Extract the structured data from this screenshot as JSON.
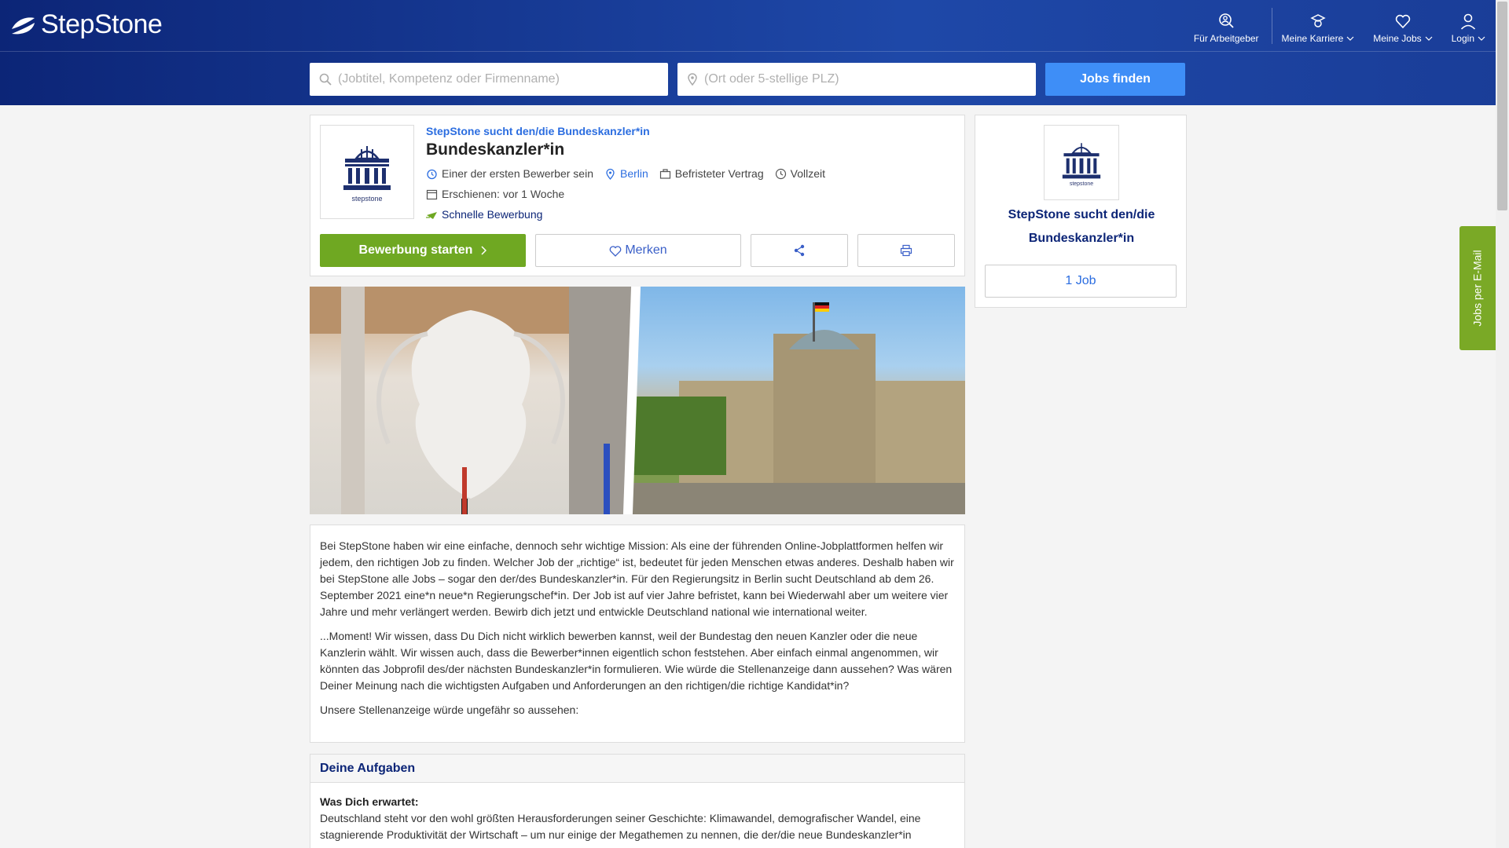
{
  "brand": {
    "name": "StepStone"
  },
  "nav": {
    "employers": "Für Arbeitgeber",
    "career": "Meine Karriere",
    "jobs": "Meine Jobs",
    "login": "Login"
  },
  "search": {
    "keyword_placeholder": "(Jobtitel, Kompetenz oder Firmenname)",
    "location_placeholder": "(Ort oder 5-stellige PLZ)",
    "button": "Jobs finden"
  },
  "job": {
    "company": "StepStone sucht den/die Bundeskanzler*in",
    "title": "Bundeskanzler*in",
    "early_applicant": "Einer der ersten Bewerber sein",
    "location": "Berlin",
    "contract": "Befristeter Vertrag",
    "worktime": "Vollzeit",
    "published": "Erschienen: vor 1 Woche",
    "quick_apply": "Schnelle Bewerbung",
    "logo_caption": "stepstone",
    "apply_button": "Bewerbung starten",
    "save_button": "Merken"
  },
  "description": {
    "p1": "Bei StepStone haben wir eine einfache, dennoch sehr wichtige Mission: Als eine der führenden Online-Jobplattformen helfen wir jedem, den richtigen Job zu finden. Welcher Job der „richtige“ ist, bedeutet für jeden Menschen etwas anderes. Deshalb haben wir bei StepStone alle Jobs – sogar den der/des Bundeskanzler*in. Für den Regierungsitz in Berlin sucht Deutschland ab dem 26. September 2021 eine*n neue*n Regierungschef*in. Der Job ist auf vier Jahre befristet, kann bei Wiederwahl aber um weitere vier Jahre und mehr verlängert werden. Bewirb dich jetzt und entwickle Deutschland national wie international weiter.",
    "p2": "...Moment! Wir wissen, dass Du Dich nicht wirklich bewerben kannst, weil der Bundestag den neuen Kanzler oder die neue Kanzlerin wählt. Wir wissen auch, dass die Bewerber*innen eigentlich schon feststehen. Aber einfach einmal angenommen, wir könnten das Jobprofil des/der nächsten Bundeskanzler*in formulieren. Wie würde die Stellenanzeige dann aussehen? Was wären Deiner Meinung nach die wichtigsten Aufgaben und Anforderungen an den richtigen/die richtige Kandidat*in?",
    "p3": "Unsere Stellenanzeige würde ungefähr so aussehen:"
  },
  "tasks": {
    "heading": "Deine Aufgaben",
    "subheading": "Was Dich erwartet:",
    "text": "Deutschland steht vor den wohl größten Herausforderungen seiner Geschichte: Klimawandel, demografischer Wandel, eine stagnierende Produktivität der Wirtschaft – um nur einige der Megathemen zu nennen, die der/die neue Bundeskanzler*in"
  },
  "sidebar": {
    "company": "StepStone sucht den/die Bundeskanzler*in",
    "jobs_button": "1 Job",
    "logo_caption": "stepstone"
  },
  "email_tab": "Jobs per E-Mail",
  "colors": {
    "header": "#0c2577",
    "accent": "#3e8ef7",
    "apply": "#6fa822"
  }
}
